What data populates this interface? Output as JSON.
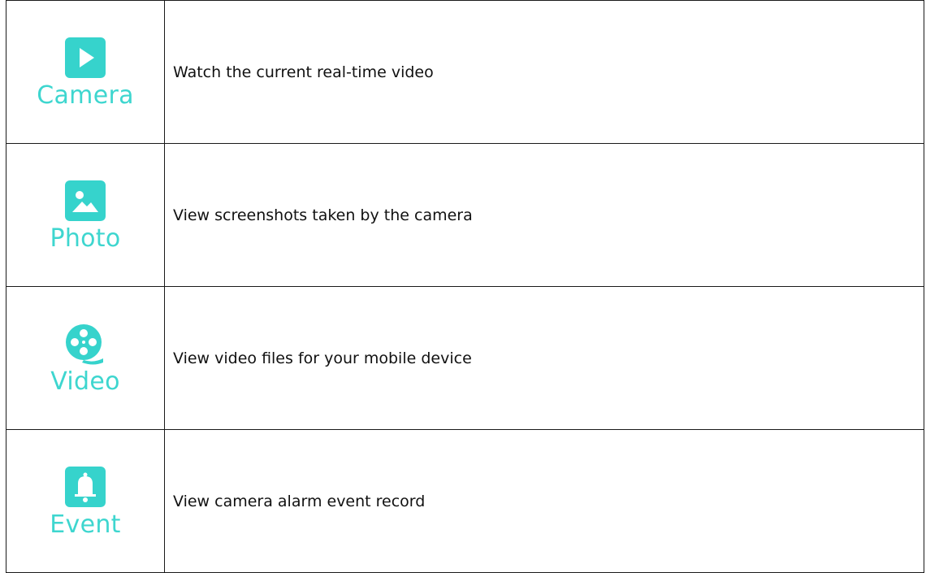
{
  "accent_color": "#36d3cc",
  "rows": [
    {
      "label": "Camera",
      "icon": "play-icon",
      "description": "Watch the current real-time video"
    },
    {
      "label": "Photo",
      "icon": "image-icon",
      "description": "View screenshots taken by the camera"
    },
    {
      "label": "Video",
      "icon": "film-reel-icon",
      "description": "View video files for your mobile device"
    },
    {
      "label": "Event",
      "icon": "bell-icon",
      "description": "View camera alarm event record"
    }
  ]
}
